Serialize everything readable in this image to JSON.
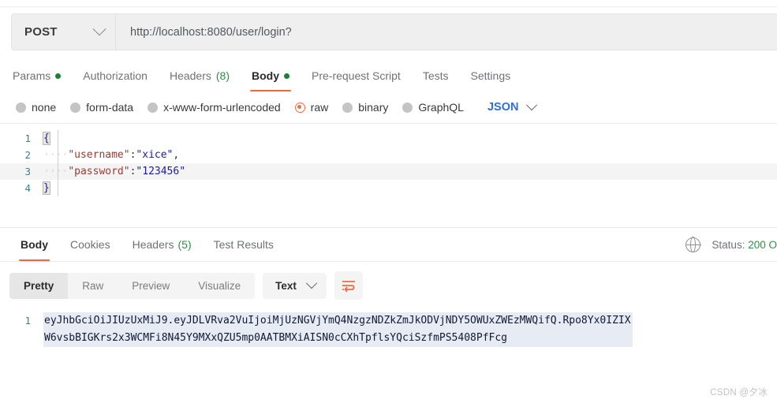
{
  "request": {
    "method": "POST",
    "url": "http://localhost:8080/user/login?",
    "tabs": [
      {
        "label": "Params",
        "badge_dot": true,
        "active": false
      },
      {
        "label": "Authorization",
        "active": false
      },
      {
        "label": "Headers",
        "count": "(8)",
        "active": false
      },
      {
        "label": "Body",
        "badge_dot": true,
        "active": true
      },
      {
        "label": "Pre-request Script",
        "active": false
      },
      {
        "label": "Tests",
        "active": false
      },
      {
        "label": "Settings",
        "active": false
      }
    ],
    "body_types": [
      {
        "label": "none",
        "checked": false
      },
      {
        "label": "form-data",
        "checked": false
      },
      {
        "label": "x-www-form-urlencoded",
        "checked": false
      },
      {
        "label": "raw",
        "checked": true
      },
      {
        "label": "binary",
        "checked": false
      },
      {
        "label": "GraphQL",
        "checked": false
      }
    ],
    "format_select": "JSON",
    "editor": {
      "lines": [
        {
          "num": "1",
          "open_brace": "{"
        },
        {
          "num": "2",
          "indent": "····",
          "key": "\"username\"",
          "colon": ":",
          "value": "\"xice\"",
          "tail": ","
        },
        {
          "num": "3",
          "indent": "····",
          "key": "\"password\"",
          "colon": ":",
          "value": "\"123456\"",
          "tail": "",
          "highlighted": true
        },
        {
          "num": "4",
          "close_brace": "}"
        }
      ]
    }
  },
  "response": {
    "tabs": [
      {
        "label": "Body",
        "active": true
      },
      {
        "label": "Cookies",
        "active": false
      },
      {
        "label": "Headers",
        "count": "(5)",
        "active": false
      },
      {
        "label": "Test Results",
        "active": false
      }
    ],
    "status_label": "Status:",
    "status_value": "200 O",
    "view_modes": [
      {
        "label": "Pretty",
        "active": true
      },
      {
        "label": "Raw",
        "active": false
      },
      {
        "label": "Preview",
        "active": false
      },
      {
        "label": "Visualize",
        "active": false
      }
    ],
    "format_dropdown": "Text",
    "line_number": "1",
    "body_line_1": "eyJhbGciOiJIUzUxMiJ9.eyJDLVRva2VuIjoiMjUzNGVjYmQ4NzgzNDZkZmJkODVjNDY5OWUxZWEzMWQifQ.",
    "body_line_2": "Rpo8Yx0IZIXW6vsbBIGKrs2x3WCMFi8N45Y9MXxQZU5mp0AATBMXiAISN0cCXhTpflsYQciSzfmPS5408PfFcg"
  },
  "watermark": "CSDN @夕冰",
  "colors": {
    "accent": "#f0673c",
    "green": "#2f8f46",
    "json_blue": "#2e6fd9",
    "token_bg": "#e6ebf4"
  }
}
